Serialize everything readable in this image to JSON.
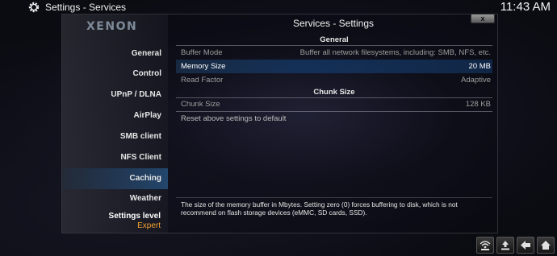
{
  "topbar": {
    "title": "Settings  -  Services",
    "time": "11:43 AM"
  },
  "sidebar": {
    "logo": "XENON",
    "items": [
      {
        "label": "General"
      },
      {
        "label": "Control"
      },
      {
        "label": "UPnP / DLNA"
      },
      {
        "label": "AirPlay"
      },
      {
        "label": "SMB client"
      },
      {
        "label": "NFS Client"
      },
      {
        "label": "Caching",
        "active": true
      },
      {
        "label": "Weather"
      }
    ],
    "settings_level_label": "Settings level",
    "settings_level_value": "Expert"
  },
  "dialog": {
    "title": "Services - Settings",
    "close_label": "x",
    "sections": {
      "general": "General",
      "chunk_size": "Chunk Size"
    },
    "rows": {
      "buffer_mode": {
        "label": "Buffer Mode",
        "value": "Buffer all network filesystems, including: SMB, NFS, etc."
      },
      "memory_size": {
        "label": "Memory Size",
        "value": "20 MB"
      },
      "read_factor": {
        "label": "Read Factor",
        "value": "Adaptive"
      },
      "chunk_size": {
        "label": "Chunk Size",
        "value": "128 KB"
      }
    },
    "reset_label": "Reset above settings to default",
    "description": "The size of the memory buffer in Mbytes. Setting zero (0) forces buffering to disk, which is not recommend on flash storage devices (eMMC, SD cards, SSD)."
  },
  "bottom_bar": {
    "icons": [
      "network-icon",
      "upload-icon",
      "back-arrow-icon",
      "home-icon"
    ]
  },
  "colors": {
    "accent": "#2d5f96",
    "settings_level": "#f0a030"
  }
}
